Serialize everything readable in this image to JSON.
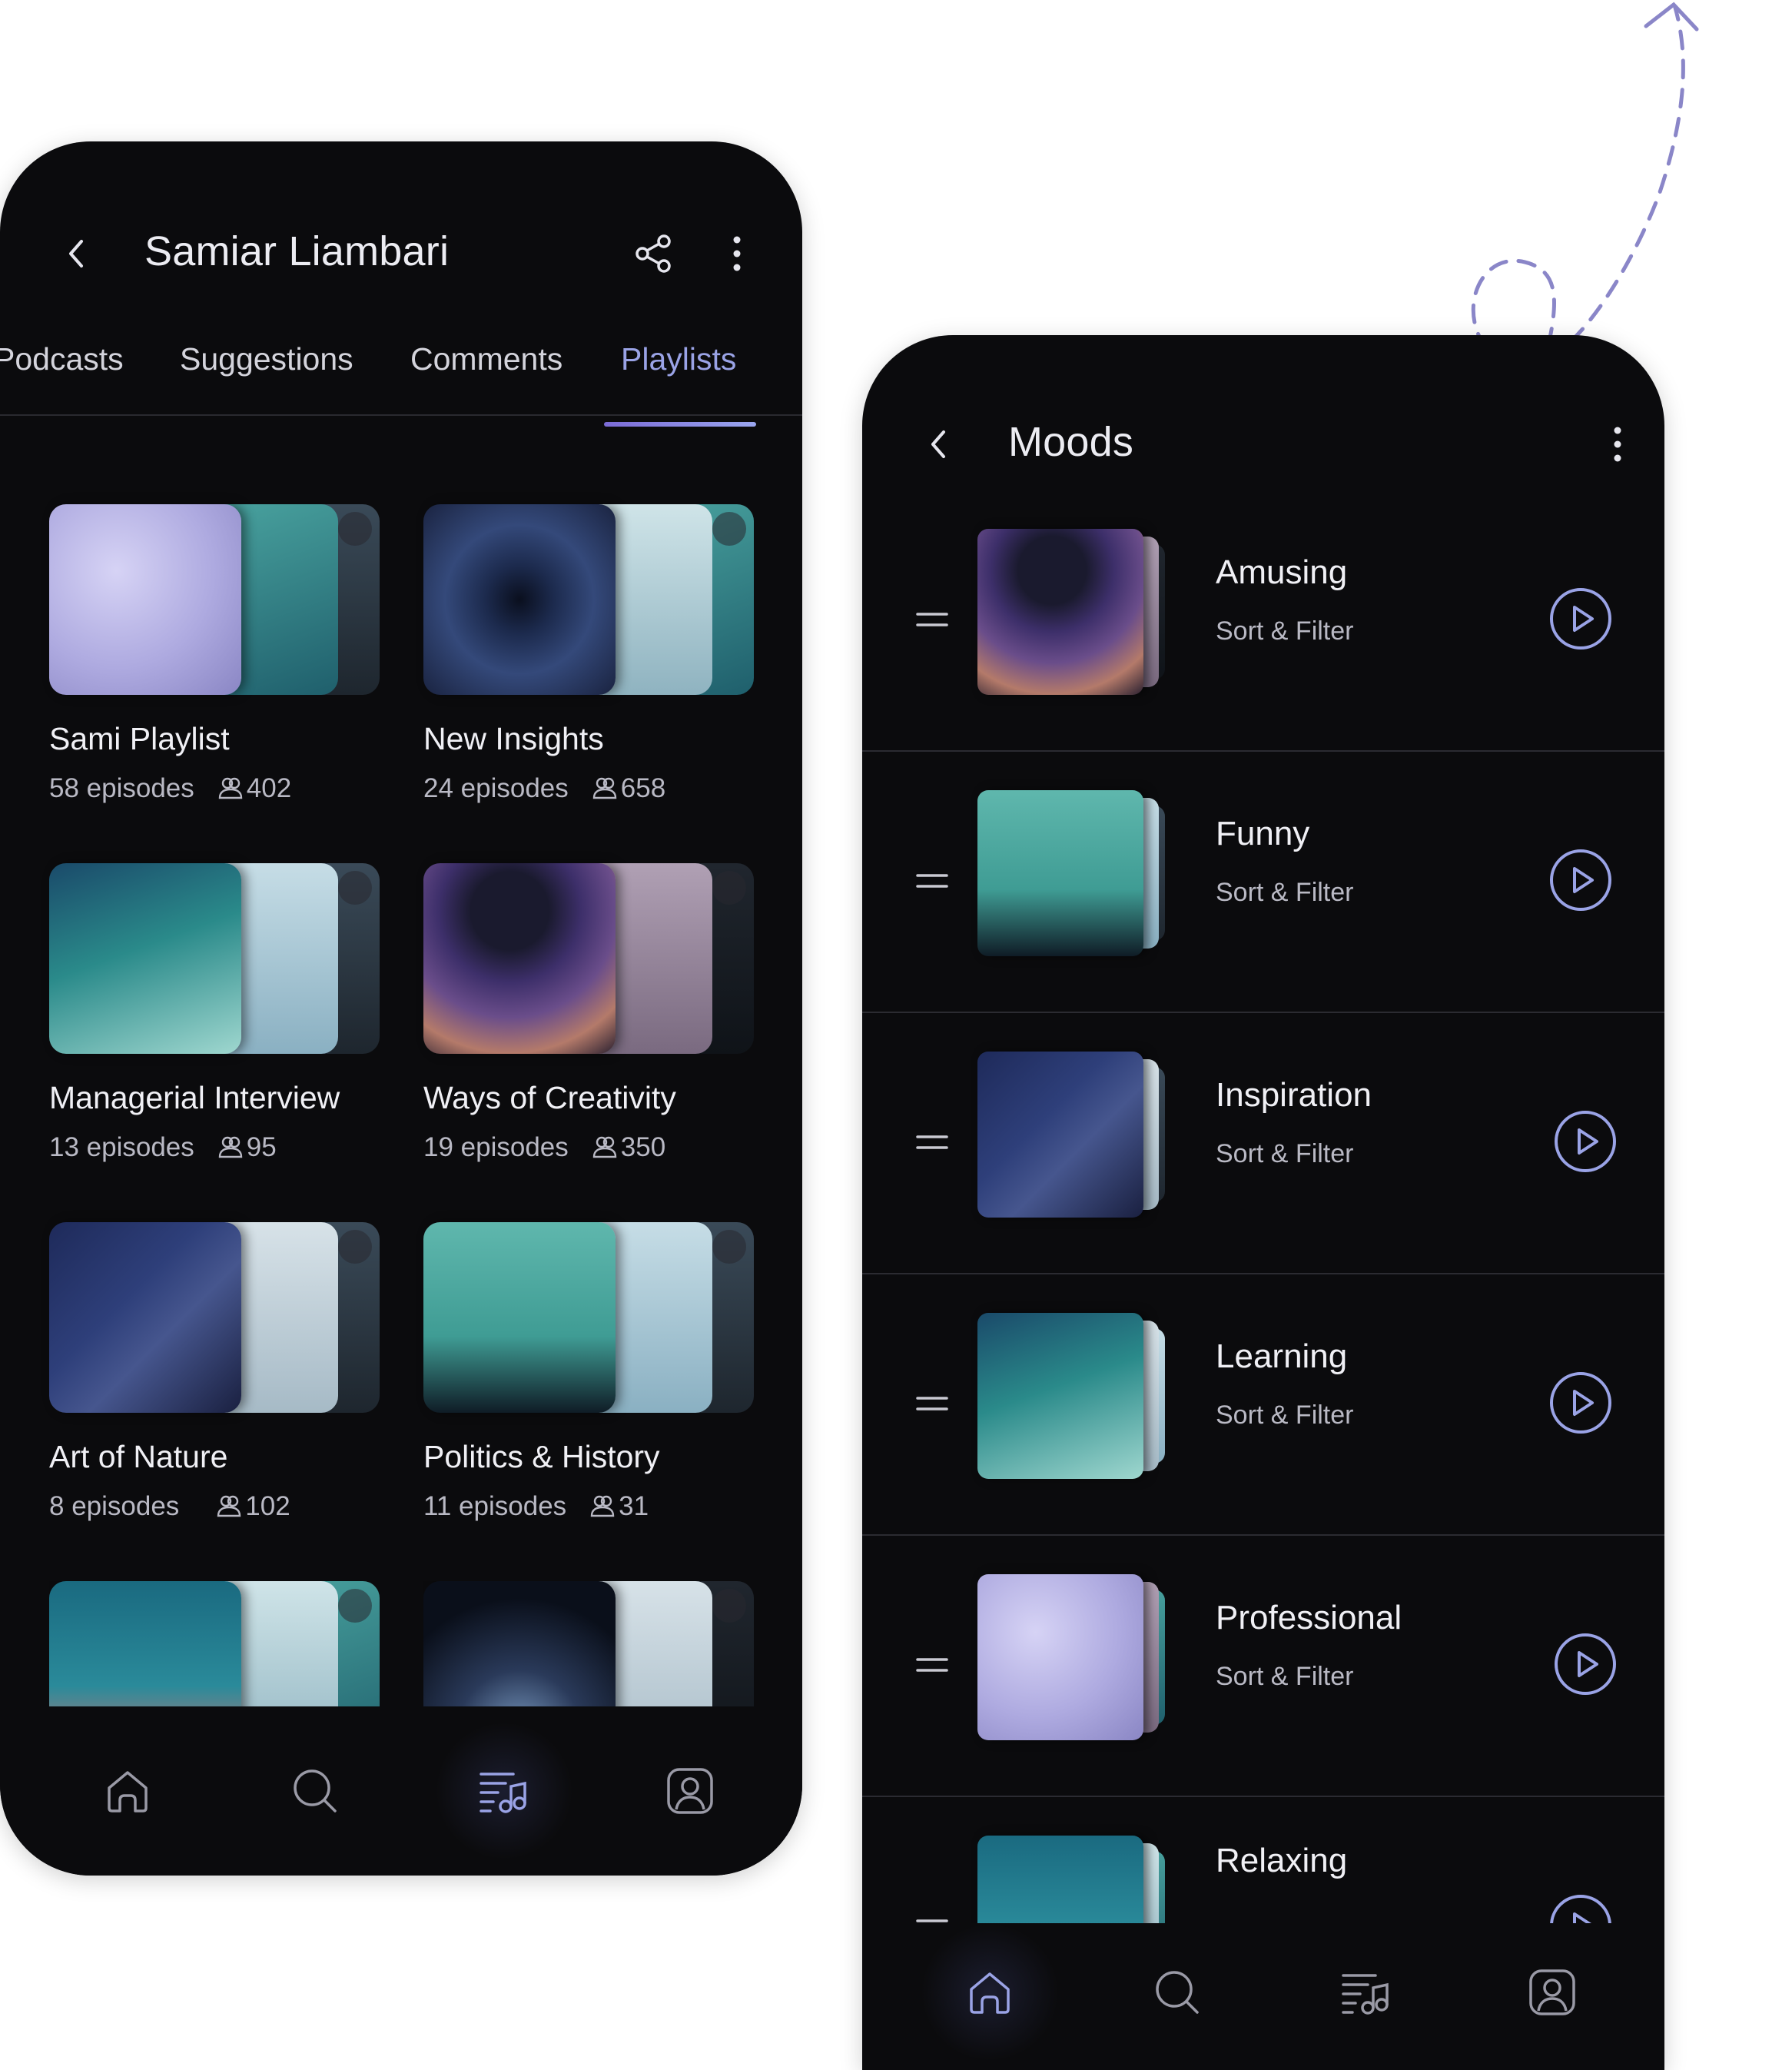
{
  "left_screen": {
    "title": "Samiar Liambari",
    "tabs": [
      {
        "label": "Podcasts",
        "active": false
      },
      {
        "label": "Suggestions",
        "active": false
      },
      {
        "label": "Comments",
        "active": false
      },
      {
        "label": "Playlists",
        "active": true
      }
    ],
    "playlists": [
      {
        "title": "Sami Playlist",
        "episodes": "58 episodes",
        "followers": "402"
      },
      {
        "title": "New Insights",
        "episodes": "24 episodes",
        "followers": "658"
      },
      {
        "title": "Managerial Interview",
        "episodes": "13 episodes",
        "followers": "95"
      },
      {
        "title": "Ways of Creativity",
        "episodes": "19 episodes",
        "followers": "350"
      },
      {
        "title": "Art of Nature",
        "episodes": "8 episodes",
        "followers": "102"
      },
      {
        "title": "Politics & History",
        "episodes": "11 episodes",
        "followers": "31"
      }
    ],
    "nav": [
      {
        "icon": "home-icon",
        "active": false
      },
      {
        "icon": "search-icon",
        "active": false
      },
      {
        "icon": "playlist-icon",
        "active": true
      },
      {
        "icon": "profile-icon",
        "active": false
      }
    ]
  },
  "right_screen": {
    "title": "Moods",
    "moods": [
      {
        "title": "Amusing",
        "subtitle": "Sort & Filter"
      },
      {
        "title": "Funny",
        "subtitle": "Sort & Filter"
      },
      {
        "title": "Inspiration",
        "subtitle": "Sort & Filter"
      },
      {
        "title": "Learning",
        "subtitle": "Sort & Filter"
      },
      {
        "title": "Professional",
        "subtitle": "Sort & Filter"
      },
      {
        "title": "Relaxing",
        "subtitle": ""
      }
    ],
    "nav": [
      {
        "icon": "home-icon",
        "active": true
      },
      {
        "icon": "search-icon",
        "active": false
      },
      {
        "icon": "playlist-icon",
        "active": false
      },
      {
        "icon": "profile-icon",
        "active": false
      }
    ]
  },
  "colors": {
    "background": "#ffffff",
    "surface": "#0b0b0d",
    "accent": "#9aa3e6",
    "text": "#ececf2",
    "muted": "#b9b9c4",
    "divider": "#2b2b31"
  }
}
